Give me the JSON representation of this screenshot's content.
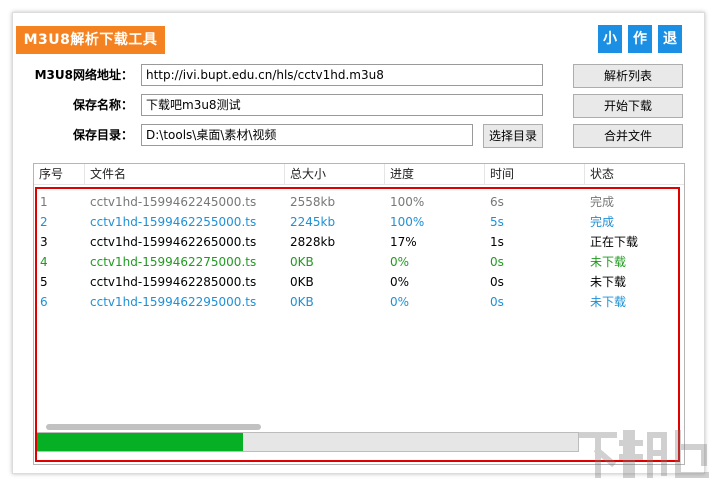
{
  "app": {
    "title": "M3U8解析下载工具",
    "accent_color": "#f58220",
    "window_buttons": [
      "小",
      "作",
      "退"
    ],
    "window_button_color": "#1a8fe3"
  },
  "form": {
    "url_label": "M3U8网络地址：",
    "url_value": "http://ivi.bupt.edu.cn/hls/cctv1hd.m3u8",
    "name_label": "保存名称：",
    "name_value": "下载吧m3u8测试",
    "dir_label": "保存目录：",
    "dir_value": "D:\\tools\\桌面\\素材\\视频",
    "choose_dir_button": "选择目录",
    "parse_button": "解析列表",
    "start_button": "开始下载",
    "merge_button": "合并文件"
  },
  "table": {
    "columns": [
      "序号",
      "文件名",
      "总大小",
      "进度",
      "时间",
      "状态"
    ],
    "rows": [
      {
        "cells": [
          "1",
          "cctv1hd-1599462245000.ts",
          "2558kb",
          "100%",
          "6s",
          "完成"
        ],
        "color": "#777777"
      },
      {
        "cells": [
          "2",
          "cctv1hd-1599462255000.ts",
          "2245kb",
          "100%",
          "5s",
          "完成"
        ],
        "color": "#1e90d6"
      },
      {
        "cells": [
          "3",
          "cctv1hd-1599462265000.ts",
          "2828kb",
          "17%",
          "1s",
          "正在下载"
        ],
        "color": "#000000"
      },
      {
        "cells": [
          "4",
          "cctv1hd-1599462275000.ts",
          "0KB",
          "0%",
          "0s",
          "未下载"
        ],
        "color": "#1f9a1f"
      },
      {
        "cells": [
          "5",
          "cctv1hd-1599462285000.ts",
          "0KB",
          "0%",
          "0s",
          "未下载"
        ],
        "color": "#000000"
      },
      {
        "cells": [
          "6",
          "cctv1hd-1599462295000.ts",
          "0KB",
          "0%",
          "0s",
          "未下载"
        ],
        "color": "#1e90d6"
      }
    ]
  },
  "progress": {
    "fraction": 0.38,
    "color": "#06b025"
  },
  "highlight_color": "#e00000"
}
